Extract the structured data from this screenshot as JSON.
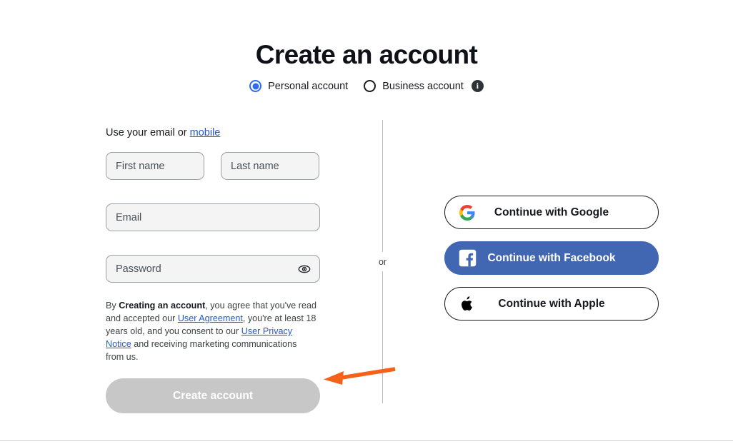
{
  "page": {
    "title": "Create an account"
  },
  "account_type": {
    "options": [
      {
        "label": "Personal account",
        "selected": true
      },
      {
        "label": "Business account",
        "selected": false
      }
    ],
    "info_icon": "info-icon",
    "info_glyph": "i"
  },
  "form": {
    "intro_prefix": "Use your email or ",
    "intro_link": "mobile",
    "fields": {
      "first_name_placeholder": "First name",
      "last_name_placeholder": "Last name",
      "email_placeholder": "Email",
      "password_placeholder": "Password",
      "first_name_value": "",
      "last_name_value": "",
      "email_value": "",
      "password_value": ""
    },
    "password_toggle_icon": "eye-icon",
    "terms": {
      "part1": "By ",
      "bold": "Creating an account",
      "part2": ", you agree that you've read and accepted our ",
      "link1": "User Agreement",
      "part3": ", you're at least 18 years old, and you consent to our ",
      "link2": "User Privacy Notice",
      "part4": " and receiving marketing communications from us."
    },
    "submit_label": "Create account",
    "submit_disabled": true
  },
  "divider": {
    "label": "or"
  },
  "social": {
    "buttons": [
      {
        "label": "Continue with Google",
        "icon": "google-icon"
      },
      {
        "label": "Continue with Facebook",
        "icon": "facebook-icon"
      },
      {
        "label": "Continue with Apple",
        "icon": "apple-icon"
      }
    ]
  },
  "annotation": {
    "arrow_icon": "arrow-left-icon",
    "color": "#f4611a",
    "points_to": "Create account"
  },
  "colors": {
    "accent_blue": "#2f6bf3",
    "link_blue": "#2557d6",
    "facebook_blue": "#4267b2",
    "disabled_gray": "#c7c7c7",
    "field_bg": "#f4f4f4",
    "annotation_orange": "#f4611a"
  }
}
